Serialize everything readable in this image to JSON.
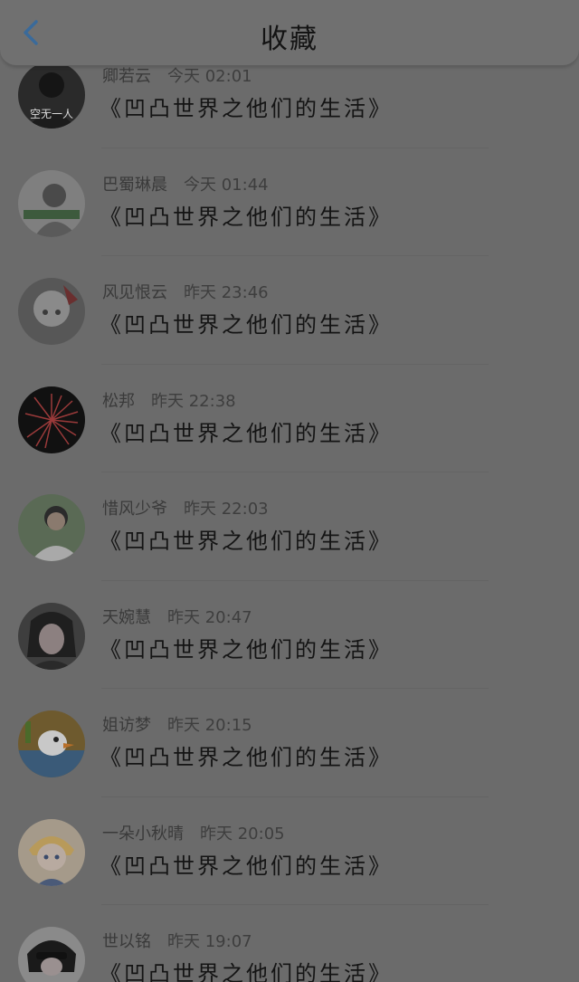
{
  "header": {
    "title": "收藏"
  },
  "items": [
    {
      "username": "卿若云",
      "time": "今天 02:01",
      "title": "《凹凸世界之他们的生活》",
      "avatar_text": "空无一人"
    },
    {
      "username": "巴蜀琳晨",
      "time": "今天 01:44",
      "title": "《凹凸世界之他们的生活》",
      "avatar_text": ""
    },
    {
      "username": "风见恨云",
      "time": "昨天 23:46",
      "title": "《凹凸世界之他们的生活》",
      "avatar_text": ""
    },
    {
      "username": "松邦",
      "time": "昨天 22:38",
      "title": "《凹凸世界之他们的生活》",
      "avatar_text": ""
    },
    {
      "username": "惜风少爷",
      "time": "昨天 22:03",
      "title": "《凹凸世界之他们的生活》",
      "avatar_text": ""
    },
    {
      "username": "天婉慧",
      "time": "昨天 20:47",
      "title": "《凹凸世界之他们的生活》",
      "avatar_text": ""
    },
    {
      "username": "姐访梦",
      "time": "昨天 20:15",
      "title": "《凹凸世界之他们的生活》",
      "avatar_text": ""
    },
    {
      "username": "一朵小秋晴",
      "time": "昨天 20:05",
      "title": "《凹凸世界之他们的生活》",
      "avatar_text": ""
    },
    {
      "username": "世以铭",
      "time": "昨天 19:07",
      "title": "《凹凸世界之他们的生活》",
      "avatar_text": ""
    }
  ],
  "icons": {
    "back": "chevron-left-icon"
  },
  "colors": {
    "accent": "#3a6a9a",
    "background": "#6b6b6b"
  }
}
